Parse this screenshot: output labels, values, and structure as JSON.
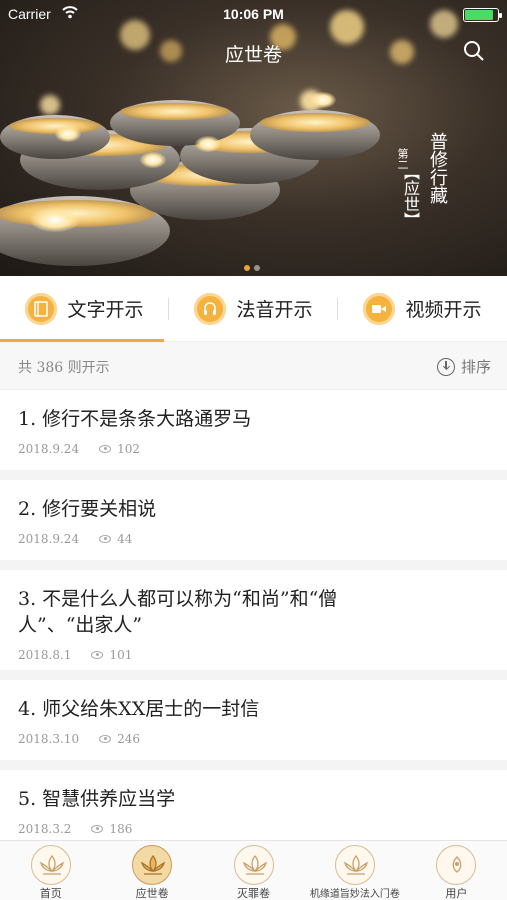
{
  "status_bar": {
    "carrier": "Carrier",
    "time": "10:06 PM",
    "wifi_icon": "wifi-icon",
    "battery_icon": "battery-icon"
  },
  "header": {
    "title": "应世卷",
    "search_icon": "search-icon",
    "banner_main": "普修行藏",
    "banner_sub_a": "第二",
    "banner_sub_b": "【应世】"
  },
  "tabs": [
    {
      "label": "文字开示",
      "icon": "book-icon",
      "active": true
    },
    {
      "label": "法音开示",
      "icon": "headphones-icon",
      "active": false
    },
    {
      "label": "视频开示",
      "icon": "video-icon",
      "active": false
    }
  ],
  "subheader": {
    "count_text": "共 386 则开示",
    "sort_label": "排序",
    "sort_icon": "sort-down-icon"
  },
  "items": [
    {
      "title": "1. 修行不是条条大路通罗马",
      "date": "2018.9.24",
      "views": "102"
    },
    {
      "title": "2. 修行要关相说",
      "date": "2018.9.24",
      "views": "44"
    },
    {
      "title": "3. 不是什么人都可以称为“和尚”和“僧人”、“出家人”",
      "date": "2018.8.1",
      "views": "101"
    },
    {
      "title": "4. 师父给朱XX居士的一封信",
      "date": "2018.3.10",
      "views": "246"
    },
    {
      "title": "5. 智慧供养应当学",
      "date": "2018.3.2",
      "views": "186"
    }
  ],
  "tabbar": [
    {
      "label": "首页",
      "icon": "lotus-icon",
      "active": false
    },
    {
      "label": "应世卷",
      "icon": "lotus-icon",
      "active": true
    },
    {
      "label": "灭罪卷",
      "icon": "lotus-icon",
      "active": false
    },
    {
      "label": "机缘道旨妙法入门卷",
      "icon": "lotus-icon",
      "active": false
    },
    {
      "label": "用户",
      "icon": "user-lotus-icon",
      "active": false
    }
  ],
  "colors": {
    "accent": "#f0a93b",
    "tab_icon_bg": "#f6b23f"
  }
}
